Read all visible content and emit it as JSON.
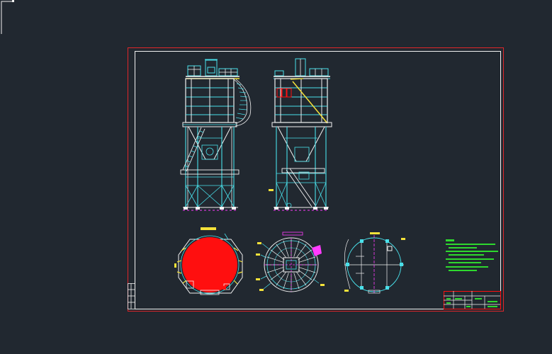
{
  "canvas": {
    "background": "#212830",
    "frame_color": "#e0262a",
    "structure_color": "#49e0ea",
    "member_color": "#f2f2f2",
    "ladder_color": "#f4e23a",
    "fill_color": "#ff0f0f",
    "text_color": "#2ed82e",
    "accent_color": "#ff3cff"
  },
  "views": [
    {
      "id": "front-elevation"
    },
    {
      "id": "side-elevation"
    },
    {
      "id": "plan-top"
    },
    {
      "id": "plan-cone-section"
    },
    {
      "id": "plan-foundation"
    }
  ],
  "notes": {
    "lines": []
  },
  "title_block": {
    "cells": []
  }
}
